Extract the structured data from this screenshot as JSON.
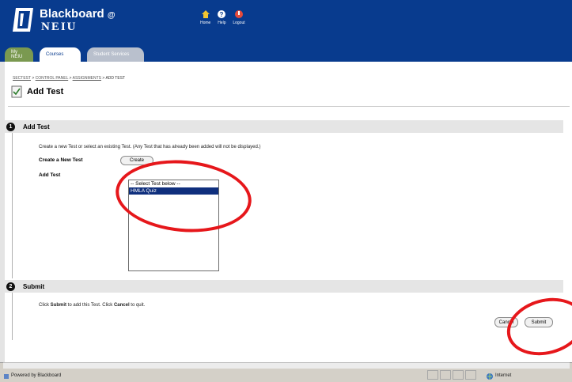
{
  "header": {
    "logo_line1": "Blackboard",
    "logo_at": "@",
    "logo_line2": "NEIU",
    "links": [
      {
        "label": "Home",
        "icon": "home-icon"
      },
      {
        "label": "Help",
        "icon": "help-icon"
      },
      {
        "label": "Logout",
        "icon": "logout-icon"
      }
    ],
    "colors": {
      "header_bg": "#083b8e",
      "annotation": "#e6171b"
    }
  },
  "tabs": [
    {
      "label": "My NEIU"
    },
    {
      "label": "Courses"
    },
    {
      "label": "Student Services"
    }
  ],
  "breadcrumb": {
    "items": [
      "SECTEST",
      "CONTROL PANEL",
      "ASSIGNMENTS",
      "ADD TEST"
    ],
    "separator": " > "
  },
  "page": {
    "title": "Add Test"
  },
  "section1": {
    "number": "1",
    "title": "Add Test",
    "instructions": "Create a new Test or select an existing Test. (Any Test that has already been added will not be displayed.)",
    "create_label": "Create a New Test",
    "create_button": "Create",
    "add_label": "Add Test",
    "options": [
      "-- Select Test below --",
      "HMLA Quiz"
    ],
    "selected_index": 1
  },
  "section2": {
    "number": "2",
    "title": "Submit",
    "instructions_pre": "Click ",
    "instructions_submit": "Submit",
    "instructions_mid": " to add this Test. Click ",
    "instructions_cancel": "Cancel",
    "instructions_post": " to quit.",
    "cancel_button": "Cancel",
    "submit_button": "Submit"
  },
  "statusbar": {
    "text": "Powered by Blackboard",
    "zone": "Internet"
  }
}
